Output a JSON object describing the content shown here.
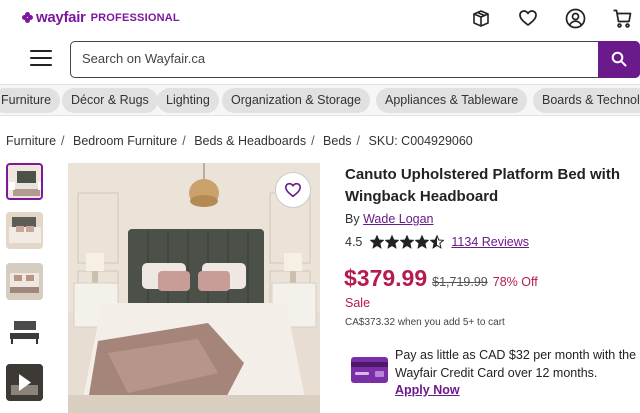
{
  "brand": {
    "name": "wayfair",
    "suffix": "PROFESSIONAL",
    "color": "#7b189f"
  },
  "header": {
    "icons": [
      "gift-box-icon",
      "heart-icon",
      "account-icon",
      "cart-icon"
    ]
  },
  "search": {
    "placeholder": "Search on Wayfair.ca",
    "button_color": "#6a1a8a"
  },
  "categories": [
    "Furniture",
    "Décor & Rugs",
    "Lighting",
    "Organization & Storage",
    "Appliances & Tableware",
    "Boards & Technol"
  ],
  "breadcrumb": {
    "items": [
      "Furniture",
      "Bedroom Furniture",
      "Beds & Headboards",
      "Beds"
    ],
    "sku": "SKU: C004929060"
  },
  "product": {
    "title": "Canuto Upholstered Platform Bed with Wingback Headboard",
    "by_prefix": "By",
    "brand": "Wade Logan",
    "rating": "4.5",
    "rating_value": 4.5,
    "reviews": "1134 Reviews",
    "price": "$379.99",
    "original_price": "$1,719.99",
    "discount": "78% Off",
    "sale_label": "Sale",
    "bulk_price_note": "CA$373.32 when you add 5+ to cart",
    "price_color": "#b51a50"
  },
  "financing": {
    "text": "Pay as little as CAD $32 per month with the Wayfair Credit Card over 12 months.",
    "link": "Apply Now"
  }
}
